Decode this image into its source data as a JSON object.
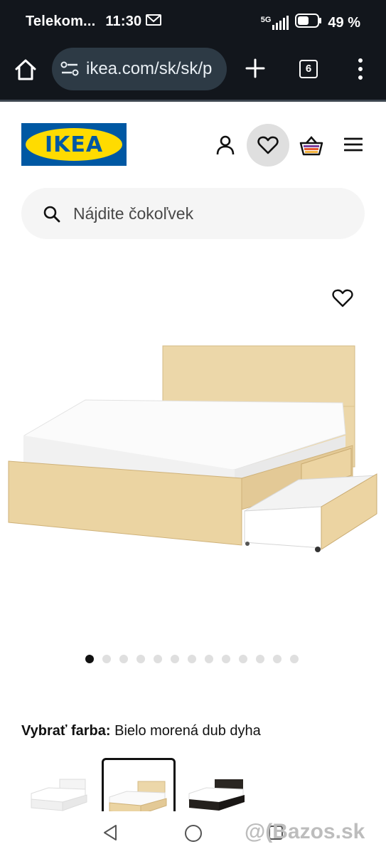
{
  "status_bar": {
    "carrier": "Telekom...",
    "time": "11:30",
    "network": "5G",
    "battery": "49 %"
  },
  "browser": {
    "url": "ikea.com/sk/sk/p",
    "tab_count": "6"
  },
  "header": {
    "logo_text": "IKEA"
  },
  "search": {
    "placeholder": "Nájdite čokoľvek"
  },
  "carousel": {
    "total_images": 13,
    "active_index": 0
  },
  "color_picker": {
    "label": "Vybrať farba:",
    "selected": "Bielo morená dub dyha",
    "swatches": [
      "white",
      "white-stained-oak",
      "black-brown"
    ]
  },
  "watermark": "@(Bazos.sk",
  "colors": {
    "status_bg": "#12161c",
    "url_bg": "#2d3a45",
    "ikea_blue": "#0058a3",
    "ikea_yellow": "#ffdb00"
  }
}
